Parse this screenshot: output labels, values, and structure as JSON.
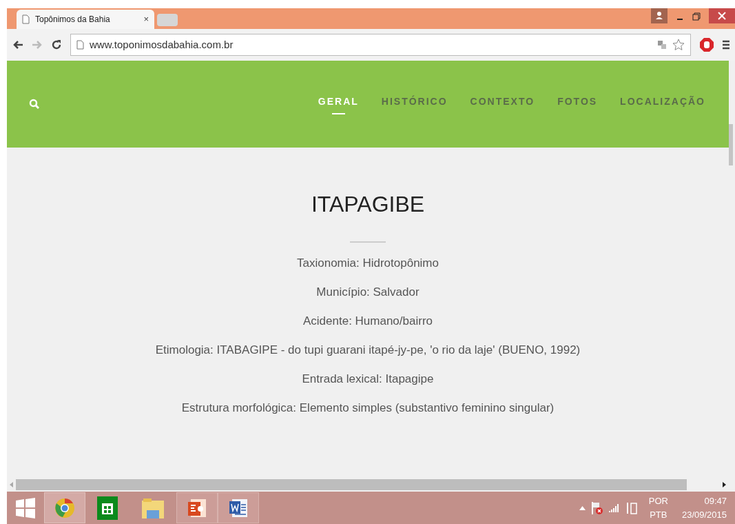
{
  "browser": {
    "tab_title": "Topônimos da Bahia",
    "tab_close": "×",
    "url": "www.toponimosdabahia.com.br"
  },
  "nav": [
    {
      "label": "GERAL",
      "selected": true
    },
    {
      "label": "HISTÓRICO",
      "selected": false
    },
    {
      "label": "CONTEXTO",
      "selected": false
    },
    {
      "label": "FOTOS",
      "selected": false
    },
    {
      "label": "LOCALIZAÇÃO",
      "selected": false
    }
  ],
  "heading": "ITAPAGIBE",
  "details": [
    "Taxionomia: Hidrotopônimo",
    "Município: Salvador",
    "Acidente: Humano/bairro",
    "Etimologia: ITABAGIPE - do tupi guarani itapé-jy-pe, 'o rio da laje' (BUENO, 1992)",
    "Entrada lexical: Itapagipe",
    "Estrutura morfológica: Elemento simples (substantivo feminino singular)"
  ],
  "taskbar": {
    "language": "POR",
    "layout": "PTB",
    "time": "09:47",
    "date": "23/09/2015"
  }
}
